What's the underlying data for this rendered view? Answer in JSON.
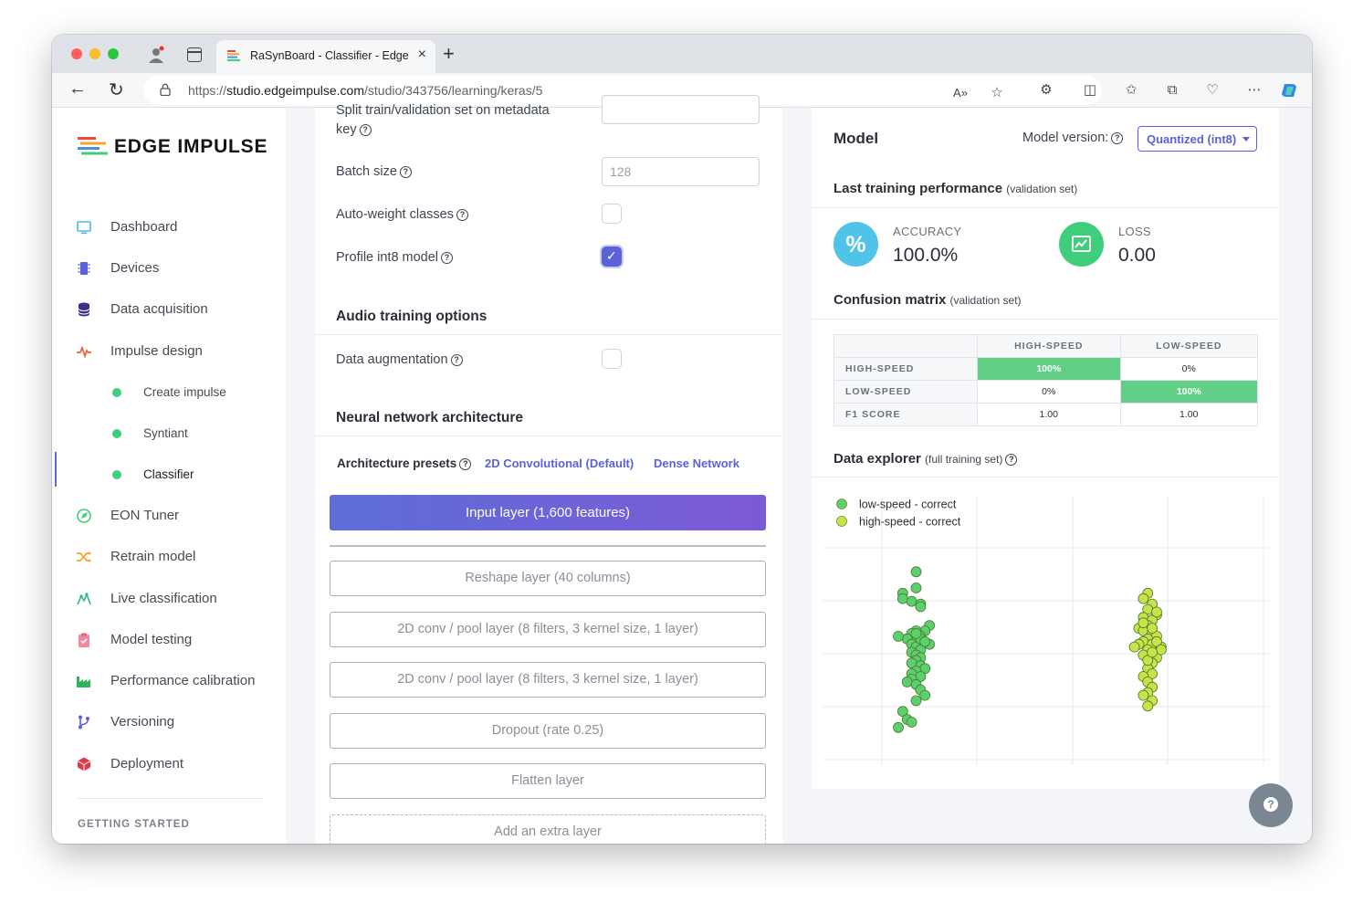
{
  "browser": {
    "tab_title": "RaSynBoard - Classifier - Edge Impulse",
    "url_prefix": "https://",
    "url_host": "studio.edgeimpulse.com",
    "url_path": "/studio/343756/learning/keras/5"
  },
  "sidebar": {
    "logo_text": "EDGE IMPULSE",
    "items": [
      {
        "label": "Dashboard",
        "icon": "monitor-icon"
      },
      {
        "label": "Devices",
        "icon": "chip-icon"
      },
      {
        "label": "Data acquisition",
        "icon": "database-icon"
      },
      {
        "label": "Impulse design",
        "icon": "pulse-icon"
      },
      {
        "label": "Create impulse"
      },
      {
        "label": "Syntiant"
      },
      {
        "label": "Classifier"
      },
      {
        "label": "EON Tuner",
        "icon": "compass-icon"
      },
      {
        "label": "Retrain model",
        "icon": "shuffle-icon"
      },
      {
        "label": "Live classification",
        "icon": "signal-icon"
      },
      {
        "label": "Model testing",
        "icon": "clipboard-icon"
      },
      {
        "label": "Performance calibration",
        "icon": "factory-icon"
      },
      {
        "label": "Versioning",
        "icon": "branch-icon"
      },
      {
        "label": "Deployment",
        "icon": "cube-icon"
      }
    ],
    "active_item": "Classifier",
    "getting_started": "GETTING STARTED"
  },
  "training": {
    "split_label_1": "Split train/validation set on metadata",
    "split_label_2": "key",
    "batch_size_label": "Batch size",
    "batch_size_placeholder": "128",
    "auto_weight_label": "Auto-weight classes",
    "auto_weight_checked": false,
    "profile_int8_label": "Profile int8 model",
    "profile_int8_checked": true,
    "audio_title": "Audio training options",
    "data_aug_label": "Data augmentation",
    "data_aug_checked": false,
    "nn_title": "Neural network architecture",
    "presets_label": "Architecture presets",
    "preset_2d": "2D Convolutional (Default)",
    "preset_dense": "Dense Network",
    "input_layer": "Input layer (1,600 features)",
    "layers": [
      "Reshape layer (40 columns)",
      "2D conv / pool layer (8 filters, 3 kernel size, 1 layer)",
      "2D conv / pool layer (8 filters, 3 kernel size, 1 layer)",
      "Dropout (rate 0.25)",
      "Flatten layer"
    ],
    "add_layer": "Add an extra layer"
  },
  "model": {
    "title": "Model",
    "version_label": "Model version:",
    "version_value": "Quantized (int8)",
    "perf_title": "Last training performance",
    "perf_note": "(validation set)",
    "accuracy_label": "ACCURACY",
    "accuracy_value": "100.0%",
    "loss_label": "LOSS",
    "loss_value": "0.00",
    "accent_accuracy": "#4fc3e8",
    "accent_loss": "#3fcf7c",
    "cm_title": "Confusion matrix",
    "cm_note": "(validation set)",
    "cm_cols": [
      "HIGH-SPEED",
      "LOW-SPEED"
    ],
    "cm_rows": [
      {
        "label": "HIGH-SPEED",
        "cells": [
          "100%",
          "0%"
        ]
      },
      {
        "label": "LOW-SPEED",
        "cells": [
          "0%",
          "100%"
        ]
      },
      {
        "label": "F1 SCORE",
        "cells": [
          "1.00",
          "1.00"
        ]
      }
    ],
    "explorer_title": "Data explorer",
    "explorer_note": "(full training set)"
  },
  "chart_data": {
    "type": "scatter",
    "title": "",
    "xlabel": "",
    "ylabel": "",
    "grid": true,
    "legend_position": "top-left",
    "series": [
      {
        "name": "high-speed - correct",
        "color": "#c8e34a",
        "points": [
          [
            0.73,
            0.64
          ],
          [
            0.72,
            0.62
          ],
          [
            0.74,
            0.6
          ],
          [
            0.73,
            0.58
          ],
          [
            0.75,
            0.56
          ],
          [
            0.72,
            0.55
          ],
          [
            0.74,
            0.54
          ],
          [
            0.73,
            0.52
          ],
          [
            0.71,
            0.51
          ],
          [
            0.72,
            0.5
          ],
          [
            0.74,
            0.49
          ],
          [
            0.75,
            0.48
          ],
          [
            0.73,
            0.47
          ],
          [
            0.72,
            0.46
          ],
          [
            0.74,
            0.45
          ],
          [
            0.76,
            0.44
          ],
          [
            0.73,
            0.43
          ],
          [
            0.72,
            0.41
          ],
          [
            0.75,
            0.4
          ],
          [
            0.74,
            0.38
          ],
          [
            0.73,
            0.36
          ],
          [
            0.74,
            0.34
          ],
          [
            0.72,
            0.33
          ],
          [
            0.73,
            0.31
          ],
          [
            0.74,
            0.29
          ],
          [
            0.73,
            0.27
          ],
          [
            0.72,
            0.26
          ],
          [
            0.74,
            0.24
          ],
          [
            0.73,
            0.22
          ],
          [
            0.75,
            0.46
          ],
          [
            0.71,
            0.45
          ],
          [
            0.7,
            0.44
          ],
          [
            0.76,
            0.43
          ],
          [
            0.74,
            0.51
          ],
          [
            0.72,
            0.53
          ],
          [
            0.75,
            0.57
          ],
          [
            0.73,
            0.39
          ],
          [
            0.74,
            0.42
          ]
        ]
      },
      {
        "name": "low-speed - correct",
        "color": "#5ccf6f",
        "points": [
          [
            0.21,
            0.72
          ],
          [
            0.21,
            0.66
          ],
          [
            0.18,
            0.64
          ],
          [
            0.18,
            0.62
          ],
          [
            0.2,
            0.61
          ],
          [
            0.22,
            0.6
          ],
          [
            0.22,
            0.59
          ],
          [
            0.24,
            0.52
          ],
          [
            0.23,
            0.5
          ],
          [
            0.21,
            0.5
          ],
          [
            0.2,
            0.49
          ],
          [
            0.22,
            0.48
          ],
          [
            0.21,
            0.46
          ],
          [
            0.19,
            0.47
          ],
          [
            0.2,
            0.45
          ],
          [
            0.21,
            0.44
          ],
          [
            0.22,
            0.43
          ],
          [
            0.2,
            0.42
          ],
          [
            0.21,
            0.41
          ],
          [
            0.22,
            0.4
          ],
          [
            0.21,
            0.39
          ],
          [
            0.2,
            0.38
          ],
          [
            0.22,
            0.37
          ],
          [
            0.23,
            0.36
          ],
          [
            0.21,
            0.35
          ],
          [
            0.2,
            0.34
          ],
          [
            0.22,
            0.33
          ],
          [
            0.2,
            0.32
          ],
          [
            0.19,
            0.31
          ],
          [
            0.21,
            0.3
          ],
          [
            0.22,
            0.28
          ],
          [
            0.23,
            0.26
          ],
          [
            0.21,
            0.24
          ],
          [
            0.18,
            0.2
          ],
          [
            0.19,
            0.17
          ],
          [
            0.17,
            0.14
          ],
          [
            0.2,
            0.16
          ],
          [
            0.24,
            0.45
          ],
          [
            0.22,
            0.47
          ],
          [
            0.21,
            0.49
          ],
          [
            0.23,
            0.46
          ],
          [
            0.17,
            0.48
          ]
        ]
      }
    ],
    "xlim": [
      0,
      1
    ],
    "ylim": [
      0,
      1
    ]
  }
}
